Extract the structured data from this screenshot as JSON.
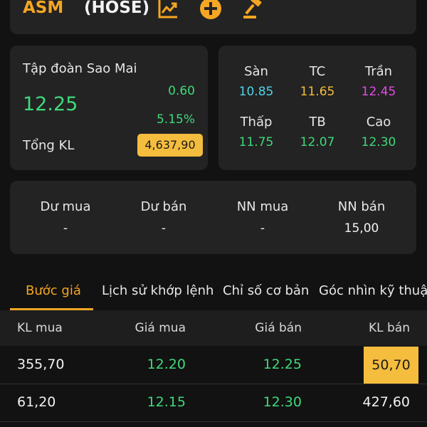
{
  "header": {
    "symbol": "ASM",
    "exchange": "(HOSE)",
    "icons": [
      "chart-icon",
      "add-circle-icon",
      "auction-hammer-icon"
    ]
  },
  "summary": {
    "company": "Tập đoàn Sao Mai",
    "price": "12.25",
    "change": "0.60",
    "change_pct": "5.15%",
    "volume_label": "Tổng KL",
    "volume_value": "4,637,90"
  },
  "price_levels": [
    {
      "label": "Sàn",
      "value": "10.85",
      "color": "#4fd3e8"
    },
    {
      "label": "TC",
      "value": "11.65",
      "color": "#f5bd3d"
    },
    {
      "label": "Trần",
      "value": "12.45",
      "color": "#e14ce6"
    },
    {
      "label": "Thấp",
      "value": "11.75",
      "color": "#3fd97a"
    },
    {
      "label": "TB",
      "value": "12.07",
      "color": "#3fd97a"
    },
    {
      "label": "Cao",
      "value": "12.30",
      "color": "#3fd97a"
    }
  ],
  "foreign": [
    {
      "label": "Dư mua",
      "value": "-"
    },
    {
      "label": "Dư bán",
      "value": "-"
    },
    {
      "label": "NN mua",
      "value": "-"
    },
    {
      "label": "NN bán",
      "value": "15,00"
    }
  ],
  "tabs": [
    "Bước giá",
    "Lịch sử khớp lệnh",
    "Chỉ số cơ bản",
    "Góc nhìn kỹ thuật"
  ],
  "order_book": {
    "headers": [
      "KL mua",
      "Giá mua",
      "Giá bán",
      "KL bán"
    ],
    "rows": [
      {
        "kl_buy": "355,70",
        "bid": "12.20",
        "ask": "12.25",
        "kl_sell": "50,70"
      },
      {
        "kl_buy": "61,20",
        "bid": "12.15",
        "ask": "12.30",
        "kl_sell": "427,60"
      }
    ]
  },
  "colors": {
    "accent": "#f5a623",
    "up": "#3fd97a",
    "highlight": "#f5bd3d"
  }
}
